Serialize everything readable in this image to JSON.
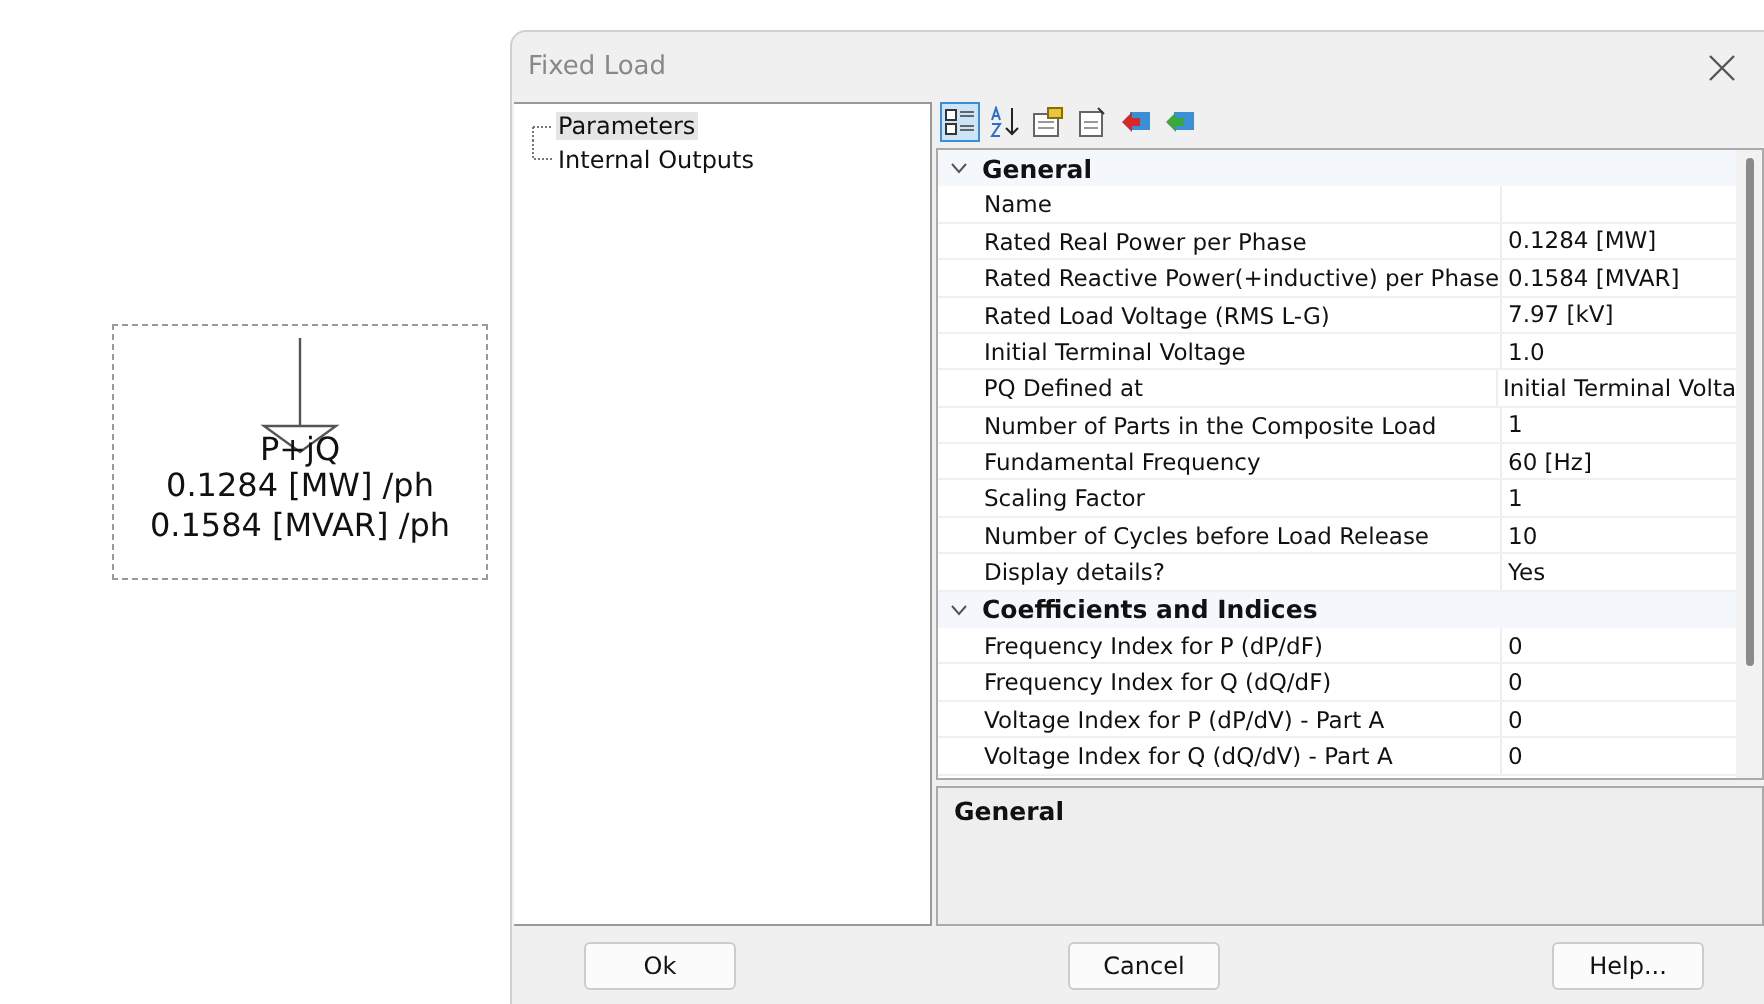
{
  "canvas": {
    "symbol_label": "P+jQ",
    "lines": [
      "0.1284 [MW] /ph",
      "0.1584 [MVAR] /ph"
    ]
  },
  "window": {
    "title": "Fixed Load"
  },
  "tree": [
    {
      "label": "Parameters",
      "selected": true
    },
    {
      "label": "Internal Outputs",
      "selected": false
    }
  ],
  "toolbar": [
    {
      "kind": "categorized",
      "selected": true
    },
    {
      "kind": "alphabetical",
      "selected": false
    },
    {
      "kind": "properties",
      "selected": false
    },
    {
      "kind": "page",
      "selected": false
    },
    {
      "kind": "import",
      "selected": false
    },
    {
      "kind": "export",
      "selected": false
    }
  ],
  "categories": [
    {
      "name": "General",
      "expanded": true,
      "rows": [
        {
          "name": "Name",
          "value": ""
        },
        {
          "name": "Rated Real Power per Phase",
          "value": "0.1284 [MW]"
        },
        {
          "name": "Rated Reactive Power(+inductive) per Phase",
          "value": "0.1584 [MVAR]"
        },
        {
          "name": "Rated Load Voltage (RMS L-G)",
          "value": "7.97 [kV]"
        },
        {
          "name": "Initial Terminal Voltage",
          "value": "1.0"
        },
        {
          "name": "PQ Defined at",
          "value": "Initial Terminal Volta"
        },
        {
          "name": "Number of Parts in the Composite Load",
          "value": "1"
        },
        {
          "name": "Fundamental Frequency",
          "value": "60 [Hz]"
        },
        {
          "name": "Scaling Factor",
          "value": "1"
        },
        {
          "name": "Number of Cycles before Load Release",
          "value": "10"
        },
        {
          "name": "Display details?",
          "value": "Yes"
        }
      ]
    },
    {
      "name": "Coefficients and Indices",
      "expanded": true,
      "rows": [
        {
          "name": "Frequency Index for P (dP/dF)",
          "value": "0"
        },
        {
          "name": "Frequency Index for Q (dQ/dF)",
          "value": "0"
        },
        {
          "name": "Voltage Index for P (dP/dV) - Part A",
          "value": "0"
        },
        {
          "name": "Voltage Index for Q (dQ/dV) - Part A",
          "value": "0"
        }
      ]
    }
  ],
  "description": {
    "title": "General"
  },
  "buttons": [
    "Ok",
    "Cancel",
    "Help..."
  ]
}
